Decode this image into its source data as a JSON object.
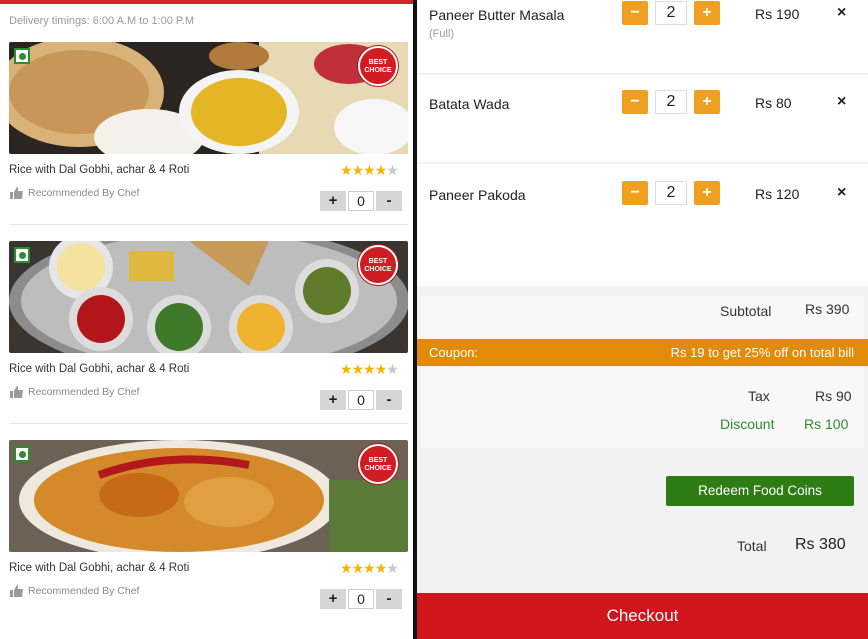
{
  "delivery_timings": "Delivery timings: 6:00 A.M to 1:00 P.M",
  "menu": {
    "items": [
      {
        "name": "Rice with Dal Gobhi, achar & 4 Roti",
        "rating": 4,
        "badge": "BEST CHOICE",
        "recommended": "Recommended By Chef",
        "quantity": "0",
        "minus": "-",
        "plus": "+"
      },
      {
        "name": "Rice with Dal Gobhi, achar & 4 Roti",
        "rating": 4,
        "badge": "BEST CHOICE",
        "recommended": "Recommended By Chef",
        "quantity": "0",
        "minus": "-",
        "plus": "+"
      },
      {
        "name": "Rice with Dal Gobhi, achar & 4 Roti",
        "rating": 4,
        "badge": "BEST CHOICE",
        "recommended": "Recommended By Chef",
        "quantity": "0",
        "minus": "-",
        "plus": "+"
      }
    ]
  },
  "cart": {
    "items": [
      {
        "name": "Paneer Butter Masala",
        "variant": "(Full)",
        "quantity": "2",
        "price": "Rs 190",
        "minus": "−",
        "plus": "+",
        "remove": "×"
      },
      {
        "name": "Batata Wada",
        "variant": "",
        "quantity": "2",
        "price": "Rs 80",
        "minus": "−",
        "plus": "+",
        "remove": "×"
      },
      {
        "name": "Paneer Pakoda",
        "variant": "",
        "quantity": "2",
        "price": "Rs 120",
        "minus": "−",
        "plus": "+",
        "remove": "×"
      }
    ],
    "subtotal_label": "Subtotal",
    "subtotal_value": "Rs 390",
    "coupon_label": "Coupon:",
    "coupon_offer": "Rs 19 to get 25% off on total bill",
    "tax_label": "Tax",
    "tax_value": "Rs 90",
    "discount_label": "Discount",
    "discount_value": "Rs 100",
    "redeem_label": "Redeem Food Coins",
    "total_label": "Total",
    "total_value": "Rs 380",
    "checkout_label": "Checkout"
  },
  "colors": {
    "brand_red": "#d0151d",
    "accent_orange": "#f0a020",
    "coupon_orange": "#e38a0a",
    "success_green": "#2e7d14",
    "star_yellow": "#f5b400"
  }
}
